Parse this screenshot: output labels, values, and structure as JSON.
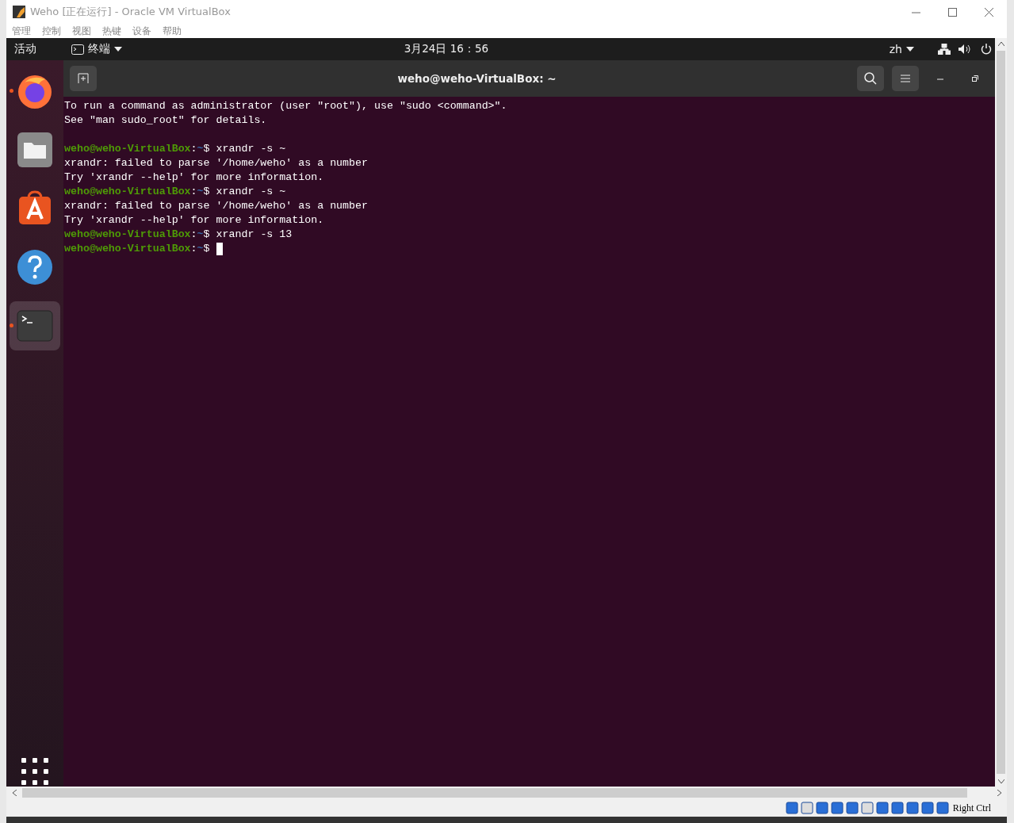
{
  "window": {
    "title": "Weho [正在运行] - Oracle VM VirtualBox"
  },
  "menu": [
    "管理",
    "控制",
    "视图",
    "热键",
    "设备",
    "帮助"
  ],
  "top_bar": {
    "activities": "活动",
    "app_name": "终端",
    "clock": "3月24日 16：56",
    "input_method": "zh"
  },
  "dock": [
    {
      "kind": "firefox",
      "running": true,
      "selected": false
    },
    {
      "kind": "files",
      "running": false,
      "selected": false
    },
    {
      "kind": "software",
      "running": false,
      "selected": false
    },
    {
      "kind": "help",
      "running": false,
      "selected": false
    },
    {
      "kind": "terminal",
      "running": true,
      "selected": true
    }
  ],
  "terminal": {
    "title": "weho@weho-VirtualBox: ~",
    "lines": [
      {
        "kind": "output",
        "text": "To run a command as administrator (user \"root\"), use \"sudo <command>\"."
      },
      {
        "kind": "output",
        "text": "See \"man sudo_root\" for details."
      },
      {
        "kind": "blank"
      },
      {
        "kind": "prompt",
        "user": "weho@weho-VirtualBox",
        "separator": ":",
        "path": "~",
        "sign": "$",
        "command": "xrandr -s ~",
        "cursor": false
      },
      {
        "kind": "output",
        "text": "xrandr: failed to parse '/home/weho' as a number"
      },
      {
        "kind": "output",
        "text": "Try 'xrandr --help' for more information."
      },
      {
        "kind": "prompt",
        "user": "weho@weho-VirtualBox",
        "separator": ":",
        "path": "~",
        "sign": "$",
        "command": "xrandr -s ~",
        "cursor": false
      },
      {
        "kind": "output",
        "text": "xrandr: failed to parse '/home/weho' as a number"
      },
      {
        "kind": "output",
        "text": "Try 'xrandr --help' for more information."
      },
      {
        "kind": "prompt",
        "user": "weho@weho-VirtualBox",
        "separator": ":",
        "path": "~",
        "sign": "$",
        "command": "xrandr -s 13",
        "cursor": false
      },
      {
        "kind": "prompt",
        "user": "weho@weho-VirtualBox",
        "separator": ":",
        "path": "~",
        "sign": "$",
        "cursor": true
      }
    ]
  },
  "status_bar": {
    "host_key": "Right Ctrl"
  }
}
